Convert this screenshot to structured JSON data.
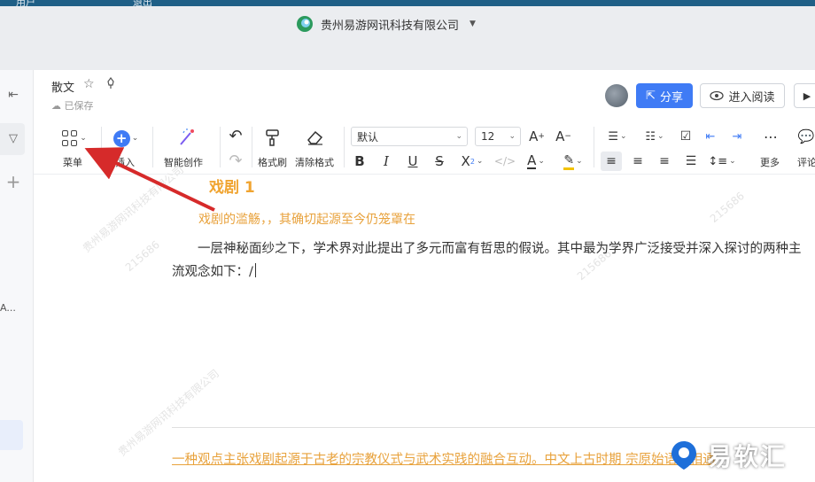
{
  "topstrip": {
    "left_text": "用户",
    "right_text": "退出"
  },
  "company": {
    "name": "贵州易游网讯科技有限公司"
  },
  "leftbar": {
    "collapse_icon": "collapse-left-icon",
    "filter_icon": "filter-icon",
    "add_icon": "plus-icon",
    "truncated_text": "A..."
  },
  "header": {
    "doc_title": "散文",
    "saved_status": "已保存",
    "share_label": "分享",
    "read_label": "进入阅读",
    "icons": {
      "star": "star-icon",
      "pin": "pin-icon",
      "cloud": "cloud-check-icon",
      "share": "share-icon",
      "eye": "eye-icon",
      "play": "play-icon"
    }
  },
  "toolbar": {
    "menu_label": "菜单",
    "insert_label": "插入",
    "ai_label": "智能创作",
    "format_painter_label": "格式刷",
    "clear_format_label": "清除格式",
    "font_family": "默认",
    "font_size": "12",
    "more_label": "更多",
    "comment_label": "评论"
  },
  "content": {
    "heading": "戏剧 1",
    "subheading": "戏剧的滥觞，，其确切起源至今仍笼罩在",
    "paragraph": "一层神秘面纱之下，学术界对此提出了多元而富有哲思的假说。其中最为学界广泛接受并深入探讨的两种主流观念如下：/",
    "underlined_paragraph": "一种观点主张戏剧起源于古老的宗教仪式与武术实践的融合互动。中文上古时期 宗原始语义相通",
    "watermarks": [
      "215686",
      "215686",
      "贵州易游网讯科技有限公司",
      "贵州易游网讯科技有限公司",
      "215686"
    ]
  },
  "brand": {
    "name": "易软汇"
  },
  "colors": {
    "accent": "#3f7bf5",
    "heading": "#f0a430",
    "topstrip": "#1f5f86",
    "arrow": "#d62a2a"
  }
}
